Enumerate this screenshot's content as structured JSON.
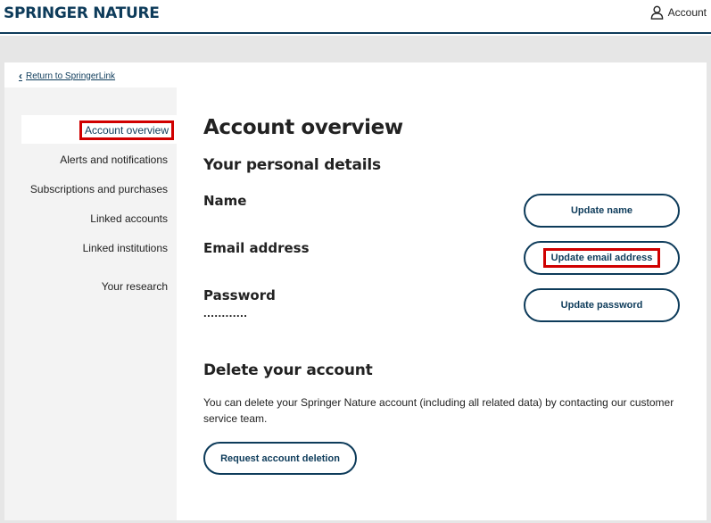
{
  "header": {
    "brand": "SPRINGER NATURE",
    "account_label": "Account",
    "account_icon": "user-icon"
  },
  "nav": {
    "back_link": "Return to SpringerLink"
  },
  "sidebar": {
    "items": [
      {
        "label": "Account overview",
        "active": true
      },
      {
        "label": "Alerts and notifications"
      },
      {
        "label": "Subscriptions and purchases"
      },
      {
        "label": "Linked accounts"
      },
      {
        "label": "Linked institutions"
      },
      {
        "label": "Your research"
      }
    ]
  },
  "main": {
    "title": "Account overview",
    "personal_heading": "Your personal details",
    "name_label": "Name",
    "email_label": "Email address",
    "password_label": "Password",
    "password_value": "............",
    "update_name": "Update name",
    "update_email": "Update email address",
    "update_password": "Update password",
    "delete_heading": "Delete your account",
    "delete_text": "You can delete your Springer Nature account (including all related data) by contacting our customer service team.",
    "delete_button": "Request account deletion"
  },
  "colors": {
    "brand": "#0d3b5a",
    "highlight": "#d00000",
    "sidebar_bg": "#f3f3f3",
    "page_bg": "#e6e6e6"
  }
}
